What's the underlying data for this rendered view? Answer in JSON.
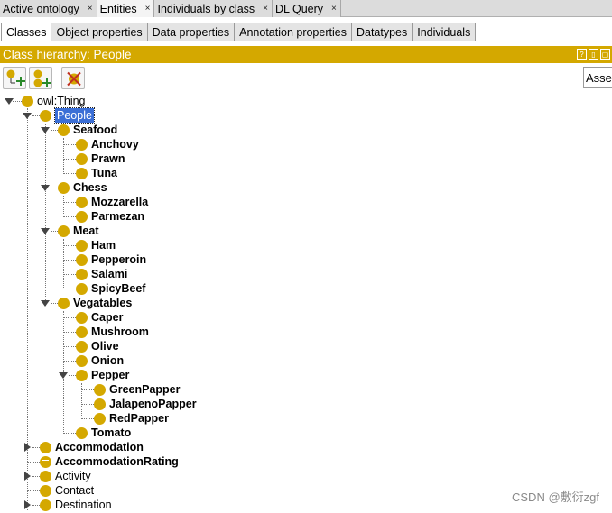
{
  "top_tabs": [
    {
      "label": "Active ontology",
      "close": "×"
    },
    {
      "label": "Entities",
      "close": "×"
    },
    {
      "label": "Individuals by class",
      "close": "×"
    },
    {
      "label": "DL Query",
      "close": "×"
    }
  ],
  "sub_tabs": [
    "Classes",
    "Object properties",
    "Data properties",
    "Annotation properties",
    "Datatypes",
    "Individuals"
  ],
  "panel": {
    "title": "Class hierarchy: People",
    "asserted_label": "Asserted"
  },
  "tree": {
    "root": "owl:Thing",
    "people": "People",
    "seafood": "Seafood",
    "anchovy": "Anchovy",
    "prawn": "Prawn",
    "tuna": "Tuna",
    "chess": "Chess",
    "mozzarella": "Mozzarella",
    "parmezan": "Parmezan",
    "meat": "Meat",
    "ham": "Ham",
    "pepperoin": "Pepperoin",
    "salami": "Salami",
    "spicybeef": "SpicyBeef",
    "vegatables": "Vegatables",
    "caper": "Caper",
    "mushroom": "Mushroom",
    "olive": "Olive",
    "onion": "Onion",
    "pepper": "Pepper",
    "greenpapper": "GreenPapper",
    "jalapenopapper": "JalapenoPapper",
    "redpapper": "RedPapper",
    "tomato": "Tomato",
    "accommodation": "Accommodation",
    "accommodationrating": "AccommodationRating",
    "activity": "Activity",
    "contact": "Contact",
    "destination": "Destination"
  },
  "watermark": "CSDN @敷衍zgf",
  "colors": {
    "accent": "#d4a800",
    "selection": "#3b6fd6"
  }
}
